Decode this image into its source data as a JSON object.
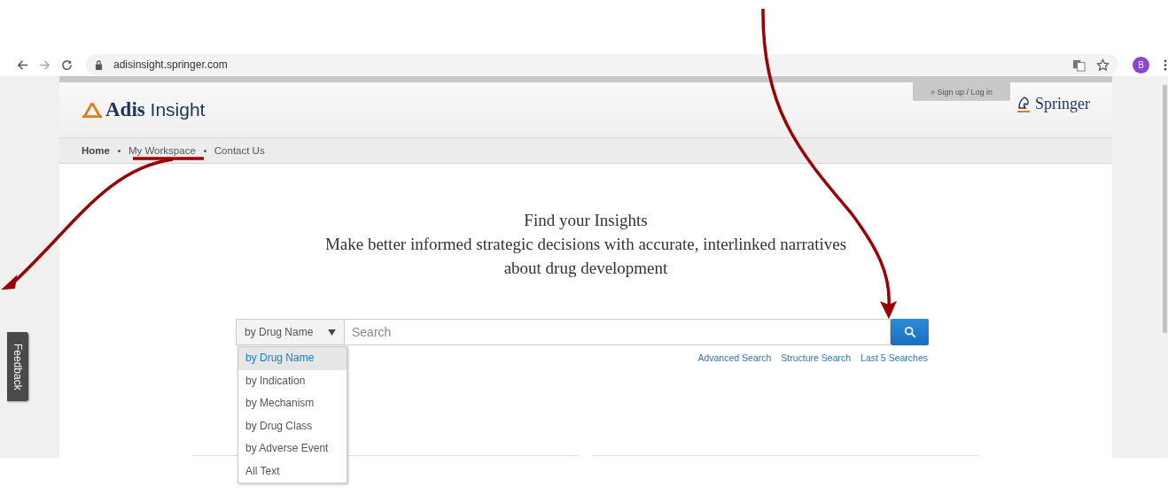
{
  "browser": {
    "url": "adisinsight.springer.com",
    "profile_initial": "B"
  },
  "header": {
    "logo_bold": "Adis",
    "logo_light": "Insight",
    "signin": "» Sign up / Log in",
    "publisher": "Springer"
  },
  "nav": [
    {
      "label": "Home",
      "selected": true
    },
    {
      "label": "My Workspace",
      "selected": false
    },
    {
      "label": "Contact Us",
      "selected": false
    }
  ],
  "hero": {
    "title": "Find your Insights",
    "subtitle": "Make better informed strategic decisions with accurate, interlinked narratives about drug development"
  },
  "search": {
    "scope": "by Drug Name",
    "placeholder": "Search",
    "options": [
      {
        "label": "by Drug Name",
        "selected": true
      },
      {
        "label": "by Indication",
        "selected": false
      },
      {
        "label": "by Mechanism",
        "selected": false
      },
      {
        "label": "by Drug Class",
        "selected": false
      },
      {
        "label": "by Adverse Event",
        "selected": false
      },
      {
        "label": "All Text",
        "selected": false
      }
    ],
    "links": [
      "Advanced Search",
      "Structure Search",
      "Last 5 Searches"
    ]
  },
  "feedback": "Feedback"
}
